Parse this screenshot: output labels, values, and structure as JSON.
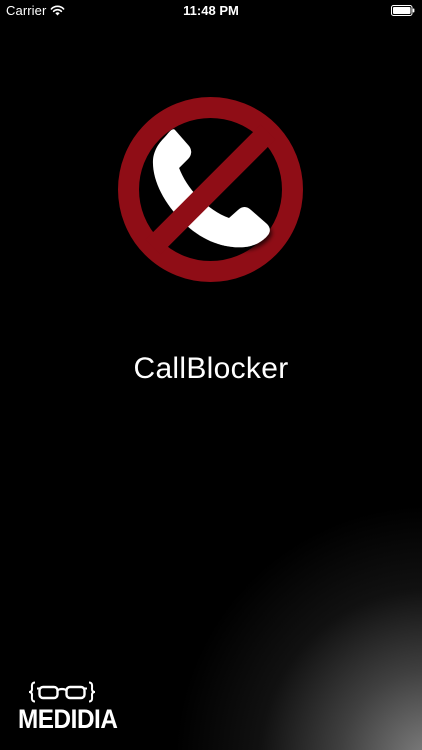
{
  "status_bar": {
    "carrier": "Carrier",
    "time": "11:48 PM"
  },
  "splash": {
    "app_name": "CallBlocker",
    "logo_icon": "blocked-phone-icon",
    "logo_colors": {
      "ring": "#8f0d16",
      "handset": "#ffffff",
      "background": "#000000"
    }
  },
  "branding": {
    "company_name": "MEDIDIA",
    "logo_icon": "glasses-braces-icon"
  }
}
